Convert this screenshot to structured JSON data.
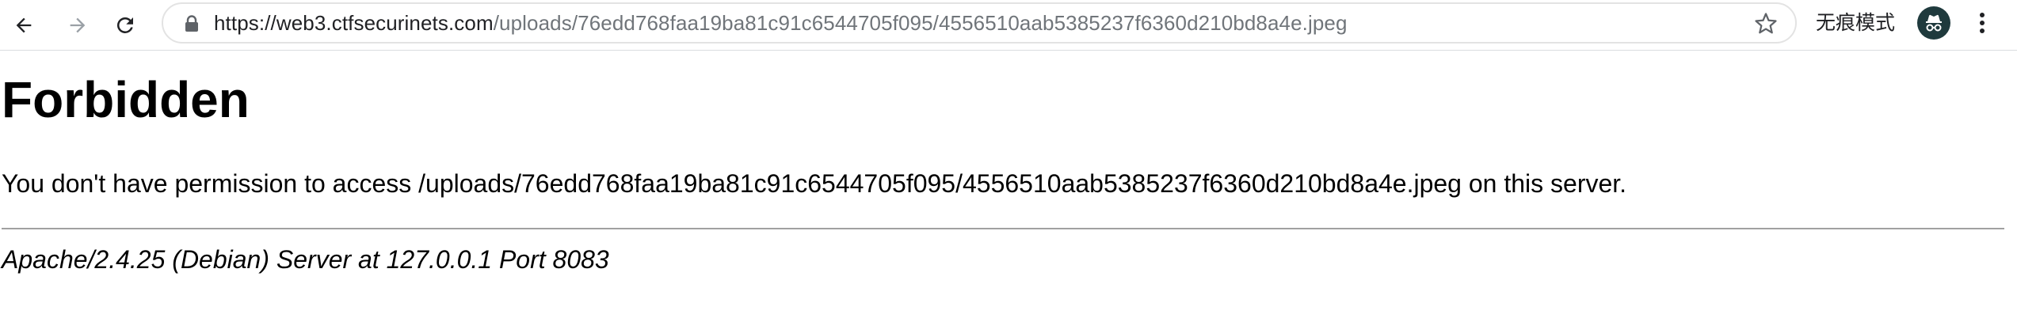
{
  "browser": {
    "url_host": "https://web3.ctfsecurinets.com",
    "url_path": "/uploads/76edd768faa19ba81c91c6544705f095/4556510aab5385237f6360d210bd8a4e.jpeg",
    "incognito_label": "无痕模式",
    "icons": {
      "back": "arrow-left-icon",
      "forward": "arrow-right-icon",
      "reload": "reload-icon",
      "lock": "lock-icon",
      "bookmark": "star-icon",
      "incognito": "incognito-icon",
      "menu": "kebab-menu-icon"
    }
  },
  "page": {
    "heading": "Forbidden",
    "message": "You don't have permission to access /uploads/76edd768faa19ba81c91c6544705f095/4556510aab5385237f6360d210bd8a4e.jpeg on this server.",
    "server_signature": "Apache/2.4.25 (Debian) Server at 127.0.0.1 Port 8083"
  }
}
